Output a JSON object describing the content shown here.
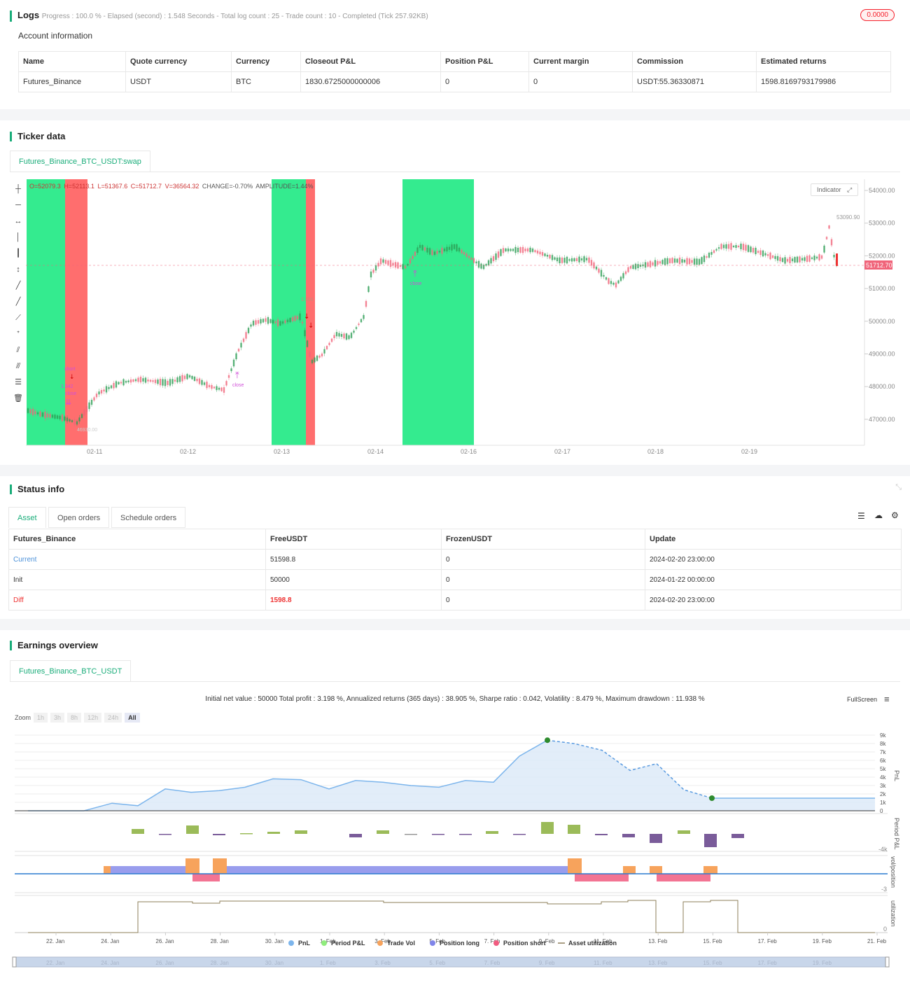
{
  "logs": {
    "title": "Logs",
    "progress": "Progress : 100.0 % - Elapsed (second) : 1.548  Seconds - Total log count : 25 - Trade count : 10 - Completed (Tick 257.92KB)",
    "badge": "0.0000"
  },
  "account": {
    "title": "Account information",
    "headers": [
      "Name",
      "Quote currency",
      "Currency",
      "Closeout P&L",
      "Position P&L",
      "Current margin",
      "Commission",
      "Estimated returns"
    ],
    "row": [
      "Futures_Binance",
      "USDT",
      "BTC",
      "1830.6725000000006",
      "0",
      "0",
      "USDT:55.36330871",
      "1598.8169793179986"
    ]
  },
  "ticker": {
    "title": "Ticker data",
    "tab": "Futures_Binance_BTC_USDT:swap",
    "ohlc": {
      "o": "O=52079.3",
      "h": "H=52113.1",
      "l": "L=51367.6",
      "c": "C=51712.7",
      "v": "V=36564.32",
      "chg": "CHANGE=-0.70%",
      "amp": "AMPLITUDE=1.44%"
    },
    "indicator_btn": "Indicator",
    "price_labels": [
      "54000.00",
      "53000.00",
      "52000.00",
      "51000.00",
      "50000.00",
      "49000.00",
      "48000.00",
      "47000.00"
    ],
    "high_label": "53090.90",
    "last_price": "51712.70",
    "date_labels": [
      "02-11",
      "02-12",
      "02-13",
      "02-14",
      "02-16",
      "02-17",
      "02-18",
      "02-19"
    ],
    "markers": {
      "short": "short",
      "qty1": "1.342",
      "close1": "close",
      "low_label": "46930.00",
      "close2": "close",
      "qty2": "1.306",
      "close3": "close"
    },
    "colors": {
      "long_zone": "#34eb8f",
      "short_zone": "#ff6e6e",
      "up": "#2e9e55",
      "down": "#f0647a"
    }
  },
  "status": {
    "title": "Status info",
    "tabs": [
      "Asset",
      "Open orders",
      "Schedule orders"
    ],
    "headers": [
      "Futures_Binance",
      "FreeUSDT",
      "FrozenUSDT",
      "Update"
    ],
    "rows": [
      [
        "Current",
        "51598.8",
        "0",
        "2024-02-20 23:00:00"
      ],
      [
        "Init",
        "50000",
        "0",
        "2024-01-22 00:00:00"
      ],
      [
        "Diff",
        "1598.8",
        "0",
        "2024-02-20 23:00:00"
      ]
    ]
  },
  "earnings": {
    "title": "Earnings overview",
    "tab": "Futures_Binance_BTC_USDT",
    "summary": "Initial net value : 50000  Total profit : 3.198 %, Annualized returns (365 days) : 38.905 %, Sharpe ratio : 0.042, Volatility : 8.479 %, Maximum drawdown : 11.938 %",
    "fullscreen": "FullScreen",
    "zoom_label": "Zoom",
    "zoom_opts": [
      "1h",
      "3h",
      "8h",
      "12h",
      "24h",
      "All"
    ],
    "pnl_ticks": [
      "9k",
      "8k",
      "7k",
      "6k",
      "5k",
      "4k",
      "3k",
      "2k",
      "1k",
      "0"
    ],
    "axis_titles": [
      "PnL",
      "Period P&L",
      "vol/position",
      "utilization"
    ],
    "ppl_tick": "-4k",
    "vol_tick": "-3",
    "util_tick": "0",
    "x_labels": [
      "22. Jan",
      "24. Jan",
      "26. Jan",
      "28. Jan",
      "30. Jan",
      "1. Feb",
      "3. Feb",
      "5. Feb",
      "7. Feb",
      "9. Feb",
      "11. Feb",
      "13. Feb",
      "15. Feb",
      "17. Feb",
      "19. Feb",
      "21. Feb"
    ],
    "legend": [
      "PnL",
      "Period P&L",
      "Trade Vol",
      "Position long",
      "Position short",
      "Asset utilization"
    ],
    "legend_colors": [
      "#7cb5ec",
      "#90ed7d",
      "#f7a35c",
      "#8085e9",
      "#f15c80",
      "#8d7f5a"
    ],
    "chart_data": {
      "type": "line",
      "x": [
        "22. Jan",
        "23. Jan",
        "24. Jan",
        "25. Jan",
        "26. Jan",
        "27. Jan",
        "28. Jan",
        "29. Jan",
        "30. Jan",
        "31. Jan",
        "1. Feb",
        "2. Feb",
        "3. Feb",
        "4. Feb",
        "5. Feb",
        "6. Feb",
        "7. Feb",
        "8. Feb",
        "9. Feb",
        "10. Feb",
        "11. Feb",
        "12. Feb",
        "13. Feb",
        "14. Feb",
        "15. Feb",
        "16. Feb",
        "21. Feb"
      ],
      "series": [
        {
          "name": "PnL",
          "values": [
            0,
            0,
            0,
            900,
            600,
            2600,
            2200,
            2400,
            2800,
            3800,
            3700,
            2600,
            3600,
            3400,
            3000,
            2800,
            3600,
            3400,
            6500,
            8400,
            8000,
            7200,
            4800,
            5600,
            2500,
            1500,
            1500
          ]
        }
      ],
      "ylim": [
        0,
        9000
      ]
    }
  }
}
